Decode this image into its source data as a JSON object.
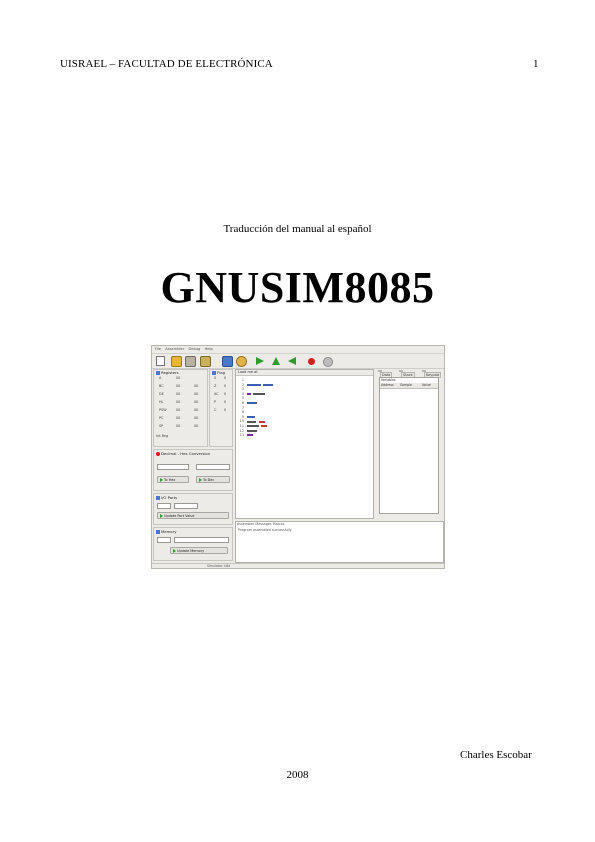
{
  "header": {
    "left": "UISRAEL – FACULTAD DE ELECTRÓNICA",
    "page_number": "1"
  },
  "subtitle": "Traducción del manual al español",
  "title": "GNUSIM8085",
  "author": "Charles Escobar",
  "year": "2008",
  "screenshot": {
    "menu": [
      "File",
      "Assembler",
      "Debug",
      "Help"
    ],
    "toolbar_icons": [
      "new-file-icon",
      "open-file-icon",
      "save-icon",
      "save-as-icon",
      "assemble-icon",
      "settings-icon",
      "run-icon",
      "step-in-icon",
      "step-back-icon",
      "breakpoint-icon",
      "stop-icon"
    ],
    "registers_label": "Registers",
    "flags_label": "Flag",
    "registers": [
      [
        "A",
        "00"
      ],
      [
        "BC",
        "00",
        "00"
      ],
      [
        "DE",
        "00",
        "00"
      ],
      [
        "HL",
        "00",
        "00"
      ],
      [
        "PSW",
        "00",
        "00"
      ],
      [
        "PC",
        "00",
        "00"
      ],
      [
        "SP",
        "00",
        "00"
      ]
    ],
    "flags": [
      "S",
      "Z",
      "AC",
      "P",
      "C"
    ],
    "flag_values": [
      "0",
      "0",
      "0",
      "0",
      "0"
    ],
    "int_reg": "Int-Reg",
    "conversion_label": "Decimal - Hex Conversion",
    "to_hex": "To Hex",
    "to_dec": "To Dec",
    "io_label": "I/O Ports",
    "update_io": "Update Port Value",
    "memory_label": "Memory",
    "update_mem": "Update Memory",
    "load_label": "Load me at",
    "code_lines": [
      "1",
      "2",
      "3",
      "4",
      "5",
      "6",
      "7",
      "8",
      "9",
      "10",
      "11",
      "12",
      "13"
    ],
    "side_tabs": [
      "Data",
      "Stack",
      "Keypad"
    ],
    "symbols_label": "Variables",
    "symbol_cols": [
      "Address",
      "Sample",
      "Value"
    ],
    "bottom_tabs": [
      "Assembler Messages",
      "Macros"
    ],
    "bottom_message": "Program assembled successfully",
    "status": "Simulator: Idle"
  }
}
